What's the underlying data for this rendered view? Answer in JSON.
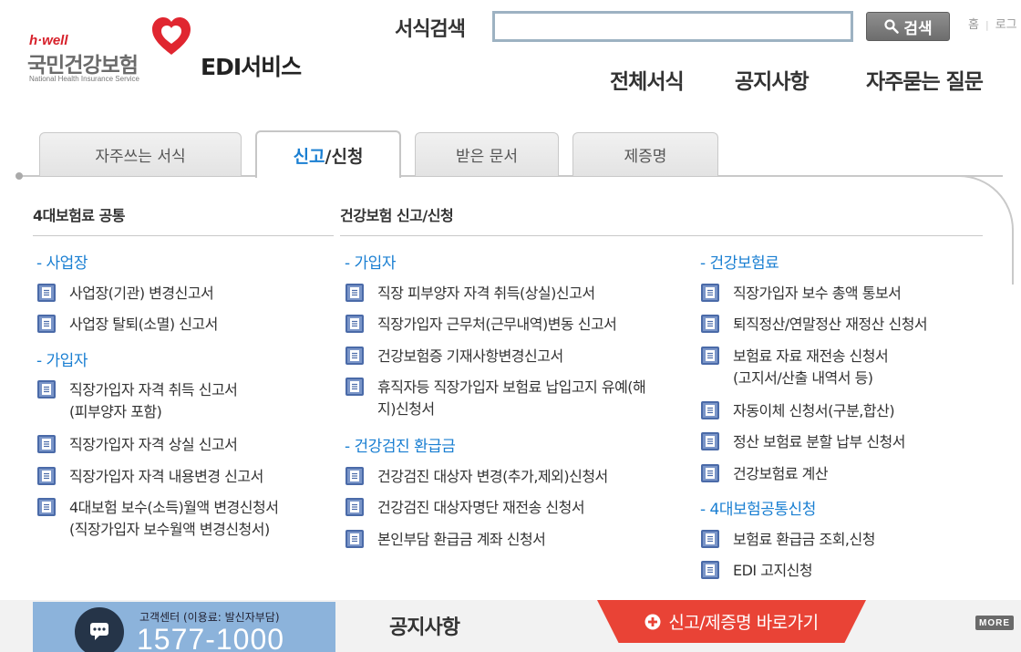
{
  "header": {
    "logo": {
      "brand": "h·well",
      "org_name": "국민건강보험",
      "org_name_en": "National Health Insurance Service"
    },
    "service_title": "EDI서비스",
    "search": {
      "label": "서식검색",
      "value": "",
      "button_label": "검색"
    },
    "util_links": [
      "홈",
      "로그"
    ],
    "gnb": [
      "전체서식",
      "공지사항",
      "자주묻는 질문"
    ]
  },
  "tabs": [
    {
      "label": "자주쓰는 서식",
      "active": false
    },
    {
      "label_prefix": "신고",
      "label_suffix": "/신청",
      "active": true
    },
    {
      "label": "받은 문서",
      "active": false
    },
    {
      "label": "제증명",
      "active": false
    }
  ],
  "sections": {
    "common": "4대보험료 공통",
    "health": "건강보험 신고/신청"
  },
  "col1": {
    "cat1": "- 사업장",
    "cat1_items": [
      "사업장(기관) 변경신고서",
      "사업장 탈퇴(소멸) 신고서"
    ],
    "cat2": "- 가입자",
    "cat2_items": [
      "직장가입자 자격 취득 신고서\n(피부양자 포함)",
      "직장가입자 자격 상실 신고서",
      "직장가입자 자격 내용변경 신고서",
      "4대보험 보수(소득)월액 변경신청서\n(직장가입자 보수월액 변경신청서)"
    ]
  },
  "col2": {
    "cat1": "- 가입자",
    "cat1_items": [
      "직장 피부양자 자격 취득(상실)신고서",
      "직장가입자 근무처(근무내역)변동 신고서",
      "건강보험증 기재사항변경신고서",
      "휴직자등 직장가입자 보험료 납입고지 유예(해\n지)신청서"
    ],
    "cat2": "- 건강검진 환급금",
    "cat2_items": [
      "건강검진 대상자 변경(추가,제외)신청서",
      "건강검진 대상자명단 재전송 신청서",
      "본인부담 환급금 계좌 신청서"
    ]
  },
  "col3": {
    "cat1": "- 건강보험료",
    "cat1_items": [
      "직장가입자 보수 총액 통보서",
      "퇴직정산/연말정산 재정산 신청서",
      "보험료 자료 재전송 신청서\n(고지서/산출 내역서 등)",
      "자동이체 신청서(구분,합산)",
      "정산 보험료 분할 납부 신청서",
      "건강보험료 계산"
    ],
    "cat2": "- 4대보험공통신청",
    "cat2_items": [
      "보험료 환급금 조회,신청",
      "EDI 고지신청"
    ]
  },
  "bottom": {
    "call_label": "고객센터 (이용료: 발신자부담)",
    "call_number": "1577-1000",
    "notice_title": "공지사항",
    "shortcut_label": "신고/제증명 바로가기",
    "more_label": "MORE"
  },
  "colors": {
    "accent_blue": "#1a7fd2",
    "brand_red": "#d7202a",
    "shortcut_red": "#e94336"
  }
}
